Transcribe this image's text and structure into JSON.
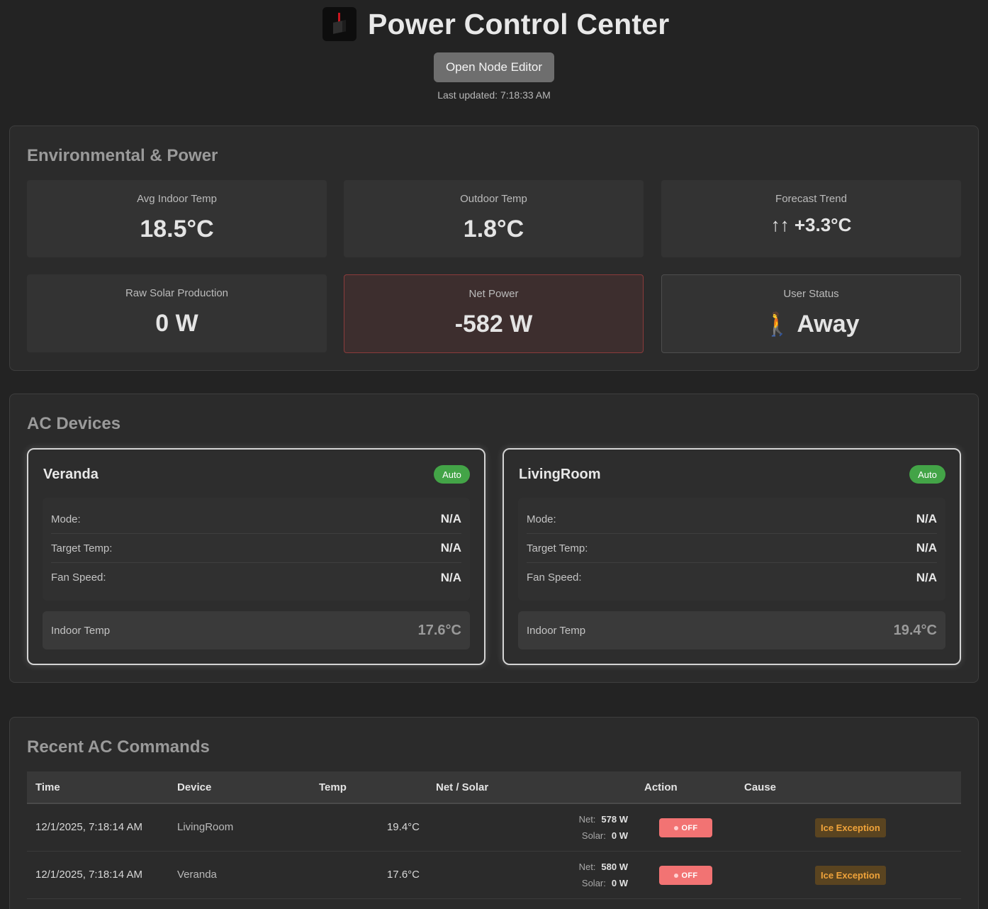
{
  "header": {
    "title": "Power Control Center",
    "logo_icon": "power-cube-logo",
    "editor_button": "Open Node Editor",
    "last_updated": "Last updated: 7:18:33 AM"
  },
  "environmental": {
    "title": "Environmental & Power",
    "avg_indoor": {
      "label": "Avg Indoor Temp",
      "value": "18.5°C"
    },
    "outdoor": {
      "label": "Outdoor Temp",
      "value": "1.8°C"
    },
    "forecast": {
      "label": "Forecast Trend",
      "value": "↑↑ +3.3°C"
    },
    "solar": {
      "label": "Raw Solar Production",
      "value": "0 W"
    },
    "net_power": {
      "label": "Net Power",
      "value": "-582 W",
      "status_color": "#8b3b3b"
    },
    "user_status": {
      "label": "User Status",
      "icon": "🚶",
      "value": "Away"
    }
  },
  "ac_devices": {
    "title": "AC Devices",
    "badge_color": "#43a447",
    "devices": [
      {
        "name": "Veranda",
        "badge": "Auto",
        "mode_label": "Mode:",
        "mode": "N/A",
        "target_label": "Target Temp:",
        "target": "N/A",
        "fan_label": "Fan Speed:",
        "fan": "N/A",
        "indoor_label": "Indoor Temp",
        "indoor": "17.6°C"
      },
      {
        "name": "LivingRoom",
        "badge": "Auto",
        "mode_label": "Mode:",
        "mode": "N/A",
        "target_label": "Target Temp:",
        "target": "N/A",
        "fan_label": "Fan Speed:",
        "fan": "N/A",
        "indoor_label": "Indoor Temp",
        "indoor": "19.4°C"
      }
    ]
  },
  "commands": {
    "title": "Recent AC Commands",
    "columns": [
      "Time",
      "Device",
      "Temp",
      "Net / Solar",
      "Action",
      "Cause"
    ],
    "action_color": "#f27373",
    "cause_color": "#f0a33a",
    "rows": [
      {
        "time": "12/1/2025, 7:18:14 AM",
        "device": "LivingRoom",
        "temp": "19.4°C",
        "net_label": "Net:",
        "net": "578 W",
        "solar_label": "Solar:",
        "solar": "0 W",
        "action": "OFF",
        "cause": "Ice Exception"
      },
      {
        "time": "12/1/2025, 7:18:14 AM",
        "device": "Veranda",
        "temp": "17.6°C",
        "net_label": "Net:",
        "net": "580 W",
        "solar_label": "Solar:",
        "solar": "0 W",
        "action": "OFF",
        "cause": "Ice Exception"
      }
    ]
  }
}
